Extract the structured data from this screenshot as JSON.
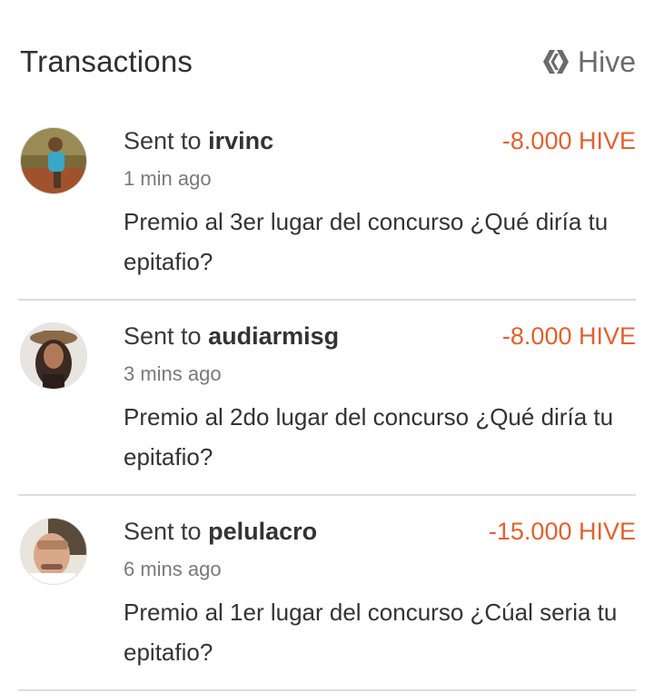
{
  "header": {
    "title": "Transactions",
    "network": "Hive",
    "network_icon": "hive-logo-icon"
  },
  "colors": {
    "amount_negative": "#e0612f",
    "divider": "#dcdcdc"
  },
  "transactions": [
    {
      "prefix": "Sent to ",
      "user": "irvinc",
      "amount": "-8.000 HIVE",
      "time": "1 min ago",
      "memo": "Premio al 3er lugar del concurso ¿Qué diría tu epitafio?",
      "avatar_icon": "user-avatar-photo"
    },
    {
      "prefix": "Sent to ",
      "user": "audiarmisg",
      "amount": "-8.000 HIVE",
      "time": "3 mins ago",
      "memo": "Premio al 2do lugar del concurso ¿Qué diría tu epitafio?",
      "avatar_icon": "user-avatar-photo"
    },
    {
      "prefix": "Sent to ",
      "user": "pelulacro",
      "amount": "-15.000 HIVE",
      "time": "6 mins ago",
      "memo": "Premio al 1er lugar del concurso ¿Cúal seria tu epitafio?",
      "avatar_icon": "user-avatar-photo"
    }
  ]
}
